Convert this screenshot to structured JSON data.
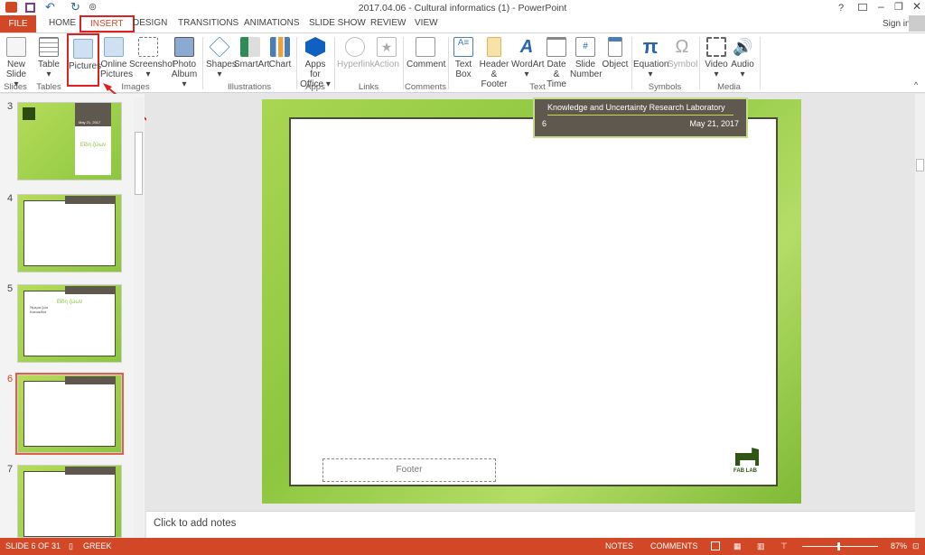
{
  "window": {
    "title": "2017.04.06 - Cultural informatics (1) - PowerPoint",
    "sign_in": "Sign in",
    "help": "?"
  },
  "tabs": [
    "FILE",
    "HOME",
    "INSERT",
    "DESIGN",
    "TRANSITIONS",
    "ANIMATIONS",
    "SLIDE SHOW",
    "REVIEW",
    "VIEW"
  ],
  "active_tab": "INSERT",
  "ribbon": {
    "buttons": [
      {
        "l1": "New",
        "l2": "Slide ▾"
      },
      {
        "l1": "Table",
        "l2": "▾"
      },
      {
        "l1": "Pictures",
        "l2": ""
      },
      {
        "l1": "Online",
        "l2": "Pictures"
      },
      {
        "l1": "Screenshot",
        "l2": "▾"
      },
      {
        "l1": "Photo",
        "l2": "Album ▾"
      },
      {
        "l1": "Shapes",
        "l2": "▾"
      },
      {
        "l1": "SmartArt",
        "l2": ""
      },
      {
        "l1": "Chart",
        "l2": ""
      },
      {
        "l1": "Apps for",
        "l2": "Office ▾"
      },
      {
        "l1": "Hyperlink",
        "l2": ""
      },
      {
        "l1": "Action",
        "l2": ""
      },
      {
        "l1": "Comment",
        "l2": ""
      },
      {
        "l1": "Text",
        "l2": "Box"
      },
      {
        "l1": "Header",
        "l2": "& Footer"
      },
      {
        "l1": "WordArt",
        "l2": "▾"
      },
      {
        "l1": "Date &",
        "l2": "Time"
      },
      {
        "l1": "Slide",
        "l2": "Number"
      },
      {
        "l1": "Object",
        "l2": ""
      },
      {
        "l1": "Equation",
        "l2": "▾"
      },
      {
        "l1": "Symbol",
        "l2": ""
      },
      {
        "l1": "Video",
        "l2": "▾"
      },
      {
        "l1": "Audio",
        "l2": "▾"
      }
    ],
    "groups": [
      "Slides",
      "Tables",
      "Images",
      "Illustrations",
      "Apps",
      "Links",
      "Comments",
      "Text",
      "Symbols",
      "Media"
    ]
  },
  "thumbnails": [
    {
      "num": "3",
      "date": "May 21, 2017",
      "title": "Είδη ζώων"
    },
    {
      "num": "4"
    },
    {
      "num": "5",
      "title": "Είδη ζώων",
      "bullets": [
        "Ήμερα ζώα",
        "Κατοικίδια"
      ]
    },
    {
      "num": "6"
    },
    {
      "num": "7"
    }
  ],
  "slide": {
    "header": "Knowledge and Uncertainty Research Laboratory",
    "number": "6",
    "date": "May 21, 2017",
    "footer": "Footer",
    "logo": "FAB LAB"
  },
  "notes_placeholder": "Click to add notes",
  "status": {
    "slide": "SLIDE 6 OF 31",
    "language": "GREEK",
    "notes": "NOTES",
    "comments": "COMMENTS",
    "zoom": "87%"
  },
  "colors": {
    "accent": "#d24726",
    "slide_green": "#8dc63f",
    "header_brown": "#5f584e",
    "highlight": "#e02020"
  }
}
